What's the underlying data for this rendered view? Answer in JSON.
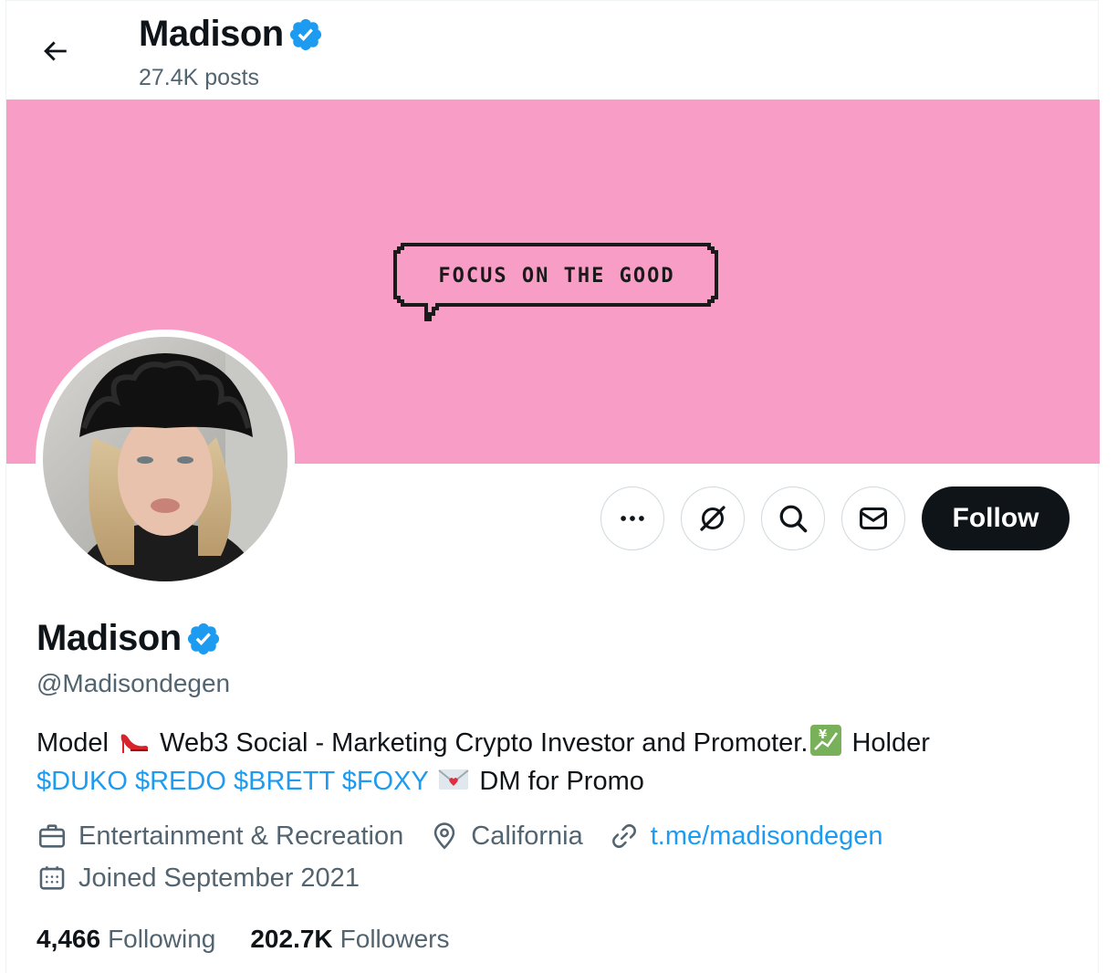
{
  "header": {
    "name": "Madison",
    "post_count": "27.4K posts"
  },
  "banner": {
    "color": "#f89dc6",
    "bubble_text": "FOCUS ON THE GOOD"
  },
  "actions": {
    "more_icon": "more-icon",
    "grok_icon": "grok-icon",
    "search_icon": "search-icon",
    "message_icon": "mail-icon",
    "follow_label": "Follow"
  },
  "profile": {
    "display_name": "Madison",
    "verified": true,
    "handle": "@Madisondegen",
    "bio": {
      "part1": "Model",
      "part2": "Web3 Social - Marketing Crypto Investor and Promoter.",
      "part3": "Holder",
      "tags": [
        "$DUKO",
        "$REDO",
        "$BRETT",
        "$FOXY"
      ],
      "part4": "DM for Promo"
    },
    "category": "Entertainment & Recreation",
    "location": "California",
    "link": "t.me/madisondegen",
    "joined": "Joined September 2021"
  },
  "stats": {
    "following_count": "4,466",
    "following_label": "Following",
    "followers_count": "202.7K",
    "followers_label": "Followers"
  },
  "colors": {
    "accent": "#1d9bf0",
    "text": "#0f1419",
    "muted": "#536471"
  }
}
